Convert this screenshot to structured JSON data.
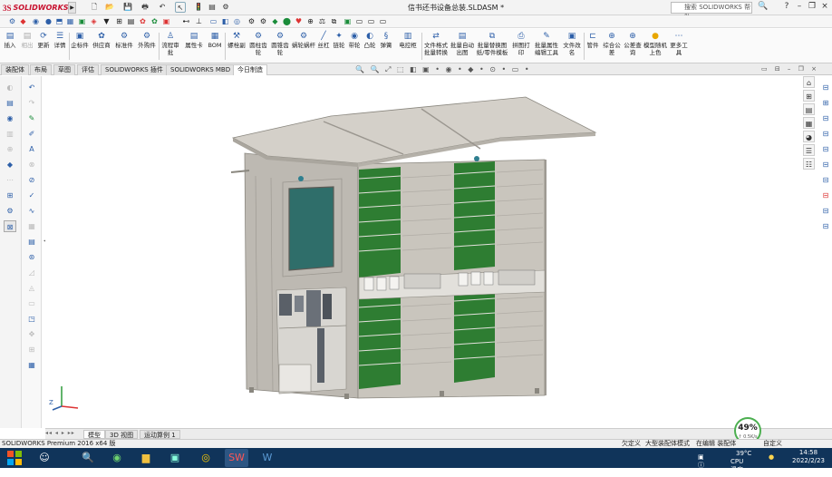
{
  "app": {
    "brand_prefix": "3S",
    "brand_name": "SOLIDWORKS",
    "document_title": "信书还书设备总装.SLDASM *",
    "help_search_placeholder": "搜索 SOLIDWORKS 帮助",
    "version_text": "SOLIDWORKS Premium 2016 x64 版"
  },
  "command_manager": {
    "items": [
      {
        "label": "插入",
        "icon": "insert-icon"
      },
      {
        "label": "相出",
        "icon": "export-icon",
        "disabled": true
      },
      {
        "label": "更新",
        "icon": "update-icon"
      },
      {
        "label": "详情",
        "icon": "details-icon"
      },
      {
        "label": "企标件",
        "icon": "enterprise-part-icon"
      },
      {
        "label": "供应商",
        "icon": "supplier-icon"
      },
      {
        "label": "标准件",
        "icon": "standard-part-icon"
      },
      {
        "label": "外购件",
        "icon": "purchased-part-icon"
      },
      {
        "label": "流程审批",
        "icon": "workflow-icon"
      },
      {
        "label": "属性卡",
        "icon": "property-card-icon"
      },
      {
        "label": "BOM",
        "icon": "bom-icon"
      },
      {
        "label": "螺栓副",
        "icon": "bolt-icon"
      },
      {
        "label": "圆柱齿轮",
        "icon": "spur-gear-icon"
      },
      {
        "label": "圆锥齿轮",
        "icon": "bevel-gear-icon"
      },
      {
        "label": "蜗轮蜗杆",
        "icon": "worm-gear-icon"
      },
      {
        "label": "丝杠",
        "icon": "lead-screw-icon"
      },
      {
        "label": "链轮",
        "icon": "sprocket-icon"
      },
      {
        "label": "带轮",
        "icon": "pulley-icon"
      },
      {
        "label": "凸轮",
        "icon": "cam-icon"
      },
      {
        "label": "弹簧",
        "icon": "spring-icon"
      },
      {
        "label": "电控柜",
        "icon": "control-cabinet-icon"
      },
      {
        "label": "文件格式批量转换",
        "icon": "file-convert-icon"
      },
      {
        "label": "批量自动出图",
        "icon": "batch-drawing-icon"
      },
      {
        "label": "批量替换图纸/零件模板",
        "icon": "template-replace-icon"
      },
      {
        "label": "拼图打印",
        "icon": "print-icon"
      },
      {
        "label": "批量属性编辑工具",
        "icon": "property-edit-icon"
      },
      {
        "label": "文件改名",
        "icon": "rename-icon"
      },
      {
        "label": "管件",
        "icon": "pipe-icon"
      },
      {
        "label": "综合公差",
        "icon": "tolerance-icon"
      },
      {
        "label": "公差查询",
        "icon": "tolerance-query-icon"
      },
      {
        "label": "模型随机上色",
        "icon": "random-color-icon"
      },
      {
        "label": "更多工具",
        "icon": "more-tools-icon"
      }
    ]
  },
  "tabs": [
    {
      "label": "装配体",
      "active": false
    },
    {
      "label": "布局",
      "active": false
    },
    {
      "label": "草图",
      "active": false
    },
    {
      "label": "评估",
      "active": false
    },
    {
      "label": "SOLIDWORKS 插件",
      "active": false
    },
    {
      "label": "SOLIDWORKS MBD",
      "active": false
    },
    {
      "label": "今日制造",
      "active": true
    }
  ],
  "model_tabs": [
    {
      "label": "模型",
      "active": true
    },
    {
      "label": "3D 视图",
      "active": false
    },
    {
      "label": "运动算例 1",
      "active": false
    }
  ],
  "status": {
    "left": "SOLIDWORKS Premium 2016 x64 版",
    "under_defined": "欠定义",
    "mode": "大型装配体模式",
    "editing": "在编辑 装配体",
    "custom": "自定义"
  },
  "cpu_gauge": {
    "percent": "49%",
    "rate": "↑ 0.5K/s"
  },
  "tray": {
    "temp": "39°C",
    "cpu_label": "CPU温度"
  },
  "clock": {
    "time": "14:58",
    "date": "2022/2/23"
  },
  "colors": {
    "cabinet_gray": "#b9b5ae",
    "door_green": "#2e7d32",
    "window_teal": "#2f6e6a",
    "taskbar": "#10345a"
  }
}
